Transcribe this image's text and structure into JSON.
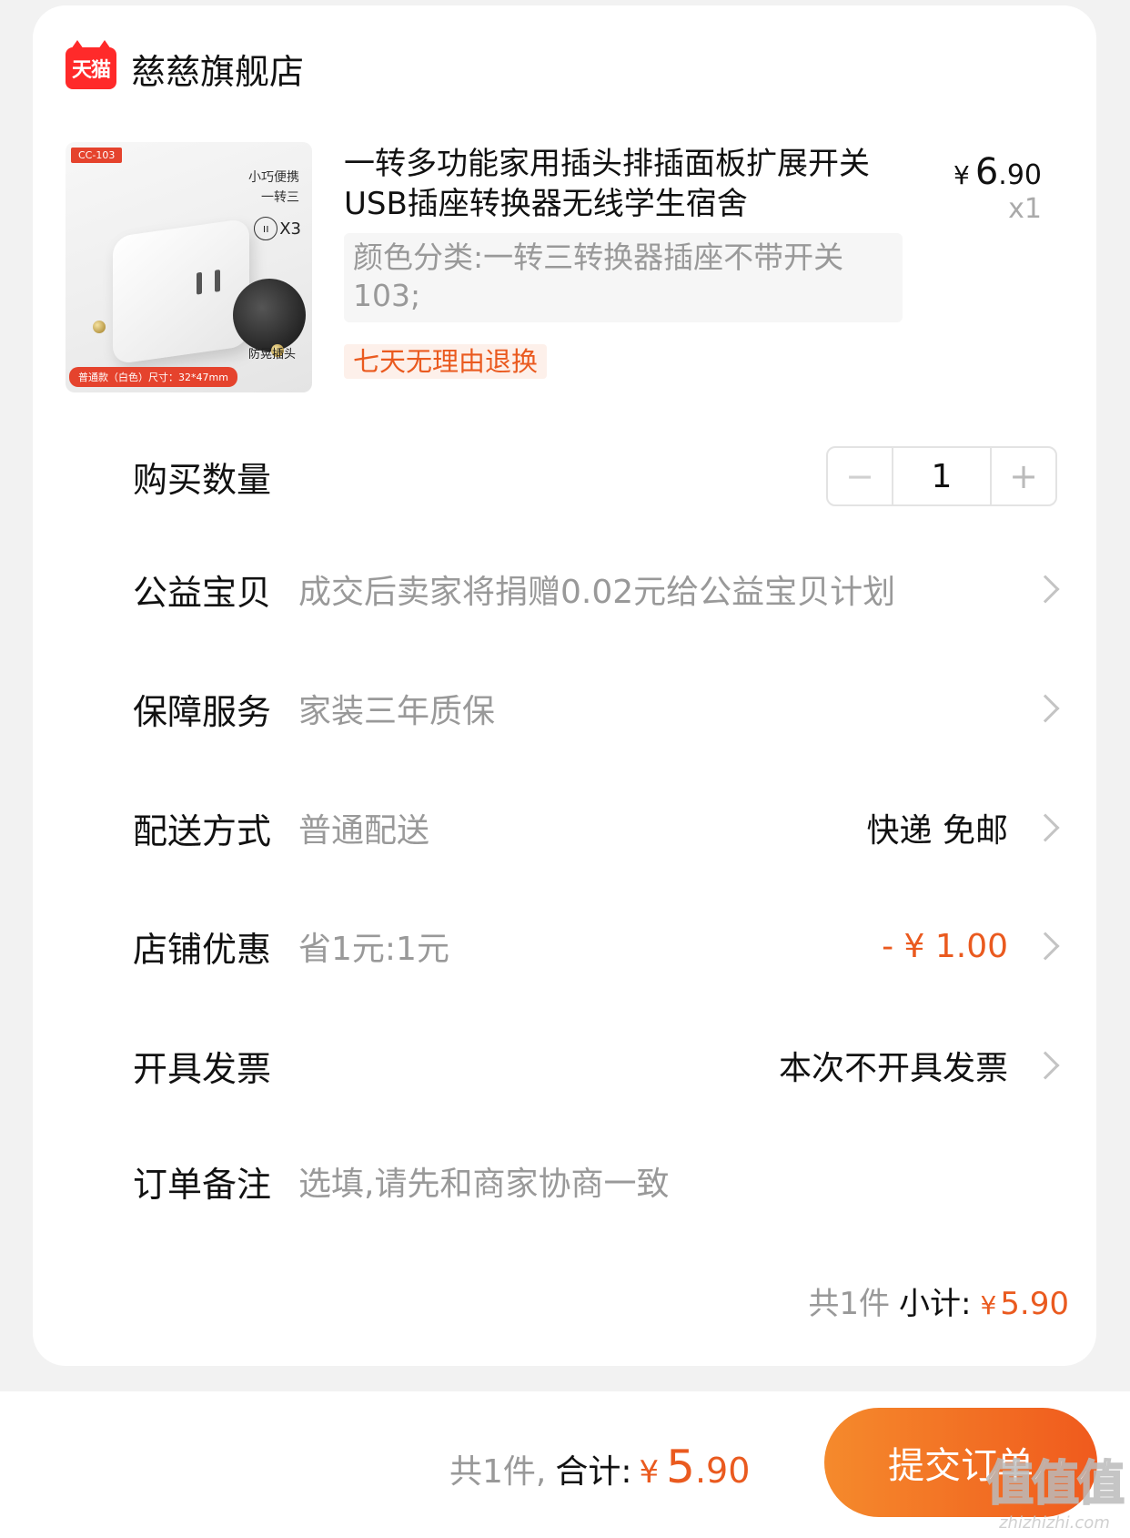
{
  "store": {
    "logo_text": "天猫",
    "name": "慈慈旗舰店"
  },
  "product": {
    "image": {
      "model_tag": "CC-103",
      "line1": "小巧便携",
      "line2": "一转三",
      "x3_label": "X3",
      "anti_label": "防晃插头",
      "spec_label": "普通款（白色）尺寸：32*47mm"
    },
    "title": "一转多功能家用插头排插面板扩展开关USB插座转换器无线学生宿舍",
    "price_currency": "¥",
    "price_int": "6",
    "price_dec": ".90",
    "quantity_label": "x1",
    "spec": "颜色分类:一转三转换器插座不带开关 103;",
    "refund_tag": "七天无理由退换"
  },
  "quantity": {
    "label": "购买数量",
    "minus": "−",
    "value": "1",
    "plus": "+"
  },
  "rows": {
    "charity": {
      "label": "公益宝贝",
      "value": "成交后卖家将捐赠0.02元给公益宝贝计划"
    },
    "warranty": {
      "label": "保障服务",
      "value": "家装三年质保"
    },
    "delivery": {
      "label": "配送方式",
      "value": "普通配送",
      "right": "快递 免邮"
    },
    "discount": {
      "label": "店铺优惠",
      "value": "省1元:1元",
      "right": "- ¥ 1.00"
    },
    "invoice": {
      "label": "开具发票",
      "right": "本次不开具发票"
    },
    "note": {
      "label": "订单备注",
      "placeholder": "选填,请先和商家协商一致"
    }
  },
  "subtotal": {
    "count": "共1件",
    "label": "小计:",
    "currency": "¥",
    "amount": "5.90"
  },
  "footer": {
    "count": "共1件,",
    "label": "合计:",
    "currency": "¥",
    "amount_int": "5",
    "amount_dec": ".90",
    "submit": "提交订单"
  },
  "watermark": {
    "big": "值值值",
    "small": "zhizhizhi.com"
  },
  "colors": {
    "accent": "#ea5a1f",
    "brand_red": "#ff2a2a",
    "button_start": "#f58a2c",
    "button_end": "#f05a1d"
  }
}
